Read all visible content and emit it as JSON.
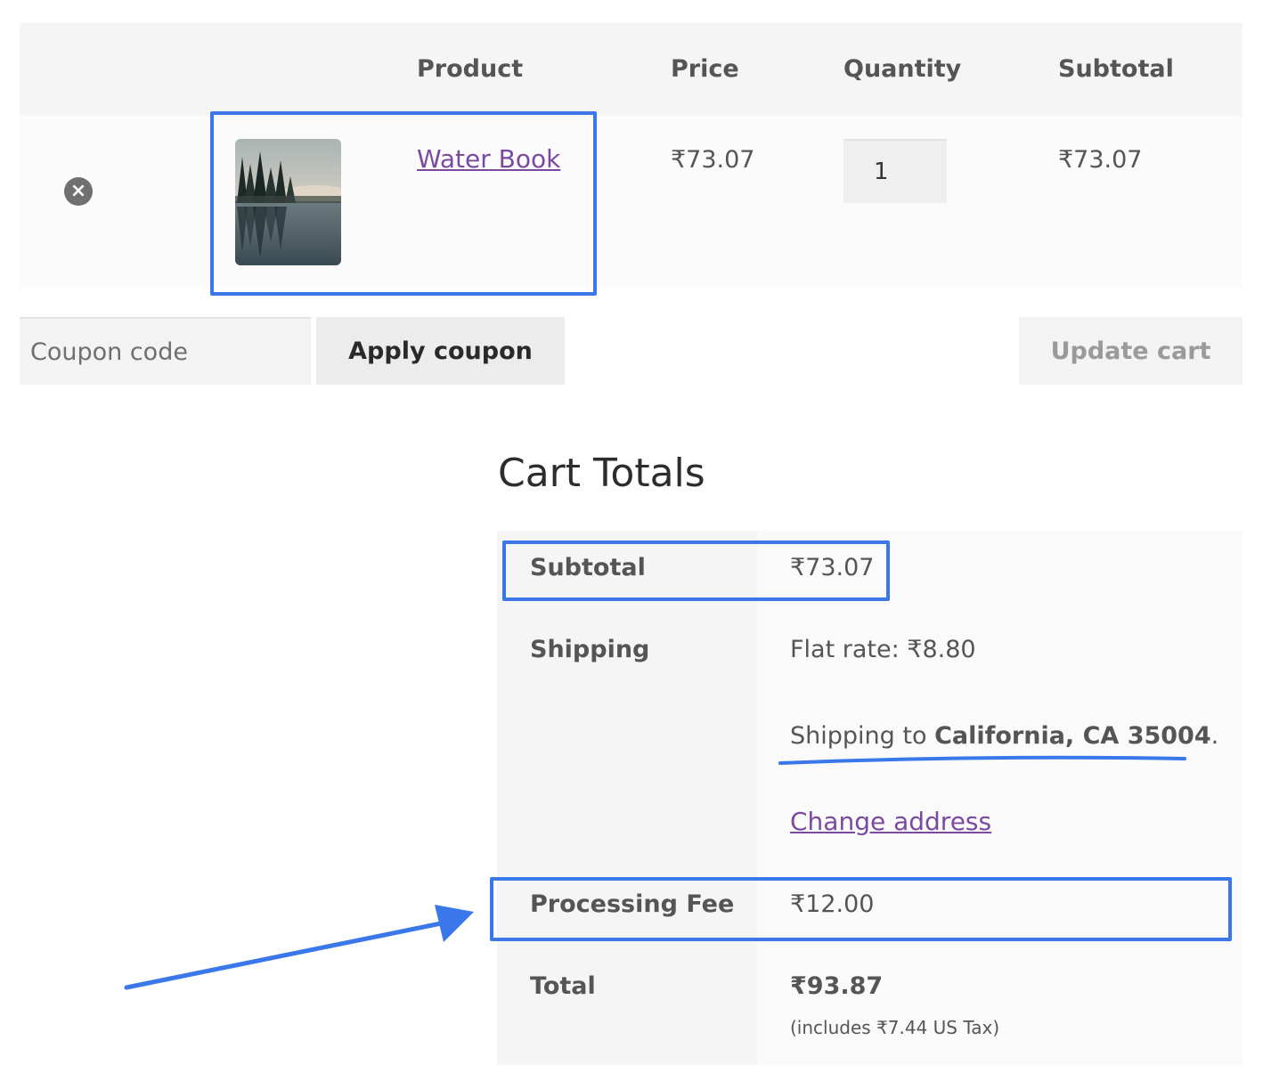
{
  "cart_table": {
    "headers": {
      "product": "Product",
      "price": "Price",
      "quantity": "Quantity",
      "subtotal": "Subtotal"
    },
    "items": [
      {
        "name": "Water Book",
        "price": "₹73.07",
        "quantity": "1",
        "subtotal": "₹73.07"
      }
    ]
  },
  "actions": {
    "coupon_placeholder": "Coupon code",
    "apply_coupon": "Apply coupon",
    "update_cart": "Update cart"
  },
  "cart_totals": {
    "title": "Cart Totals",
    "subtotal_label": "Subtotal",
    "subtotal_value": "₹73.07",
    "shipping_label": "Shipping",
    "shipping_method": "Flat rate: ₹8.80",
    "shipping_to_prefix": "Shipping to",
    "shipping_to_location": "California, CA 35004",
    "shipping_to_suffix": ".",
    "change_address": "Change address",
    "fee_label": "Processing Fee",
    "fee_value": "₹12.00",
    "total_label": "Total",
    "total_value": "₹93.87",
    "tax_note": "(includes ₹7.44 US Tax)"
  },
  "colors": {
    "link": "#7a4aa0",
    "annotation": "#3a78e9"
  },
  "icons": {
    "remove": "remove-circle-icon",
    "annotation_arrow": "arrow-icon"
  }
}
